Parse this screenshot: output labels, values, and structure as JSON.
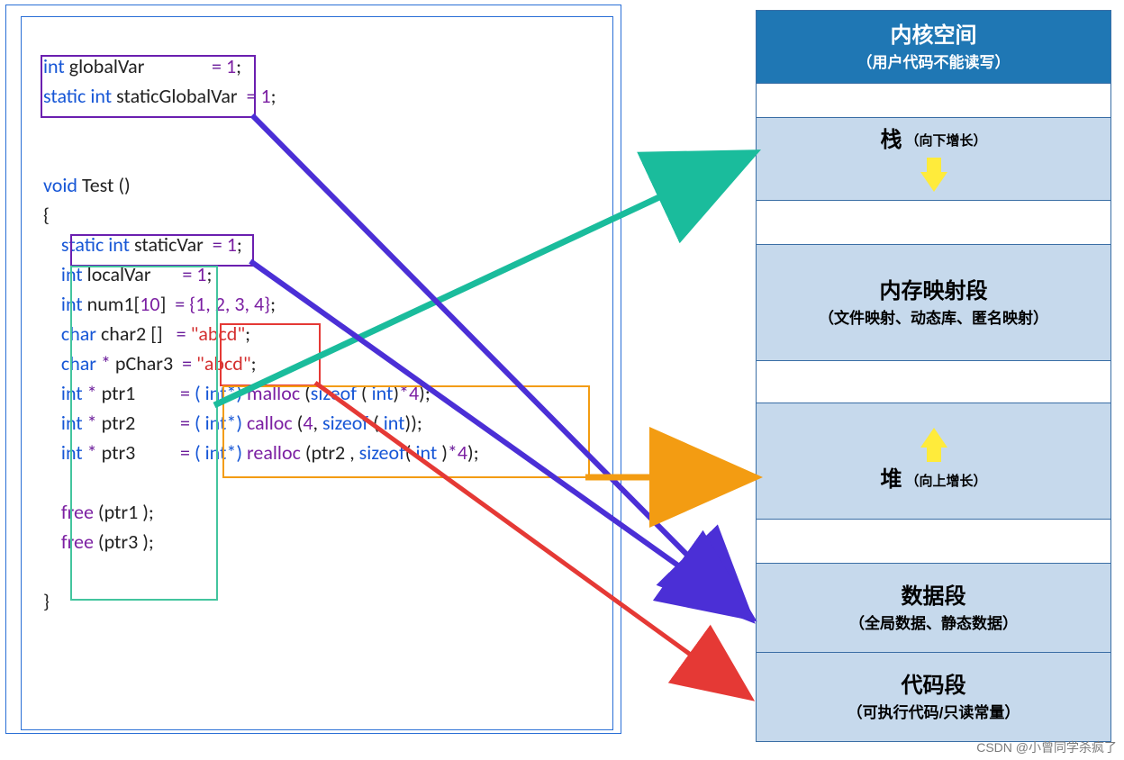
{
  "code": {
    "kw_int": "int",
    "kw_static": "static",
    "kw_void": "void",
    "kw_char": "char",
    "kw_sizeof": "sizeof",
    "globalVar": "globalVar",
    "staticGlobalVar": "staticGlobalVar",
    "Test": "Test",
    "staticVar": "staticVar",
    "localVar": "localVar",
    "num1": "num1",
    "num1_dim": "10",
    "arr_init": "{1, 2, 3, 4}",
    "char2": "char2",
    "pChar3": "pChar3",
    "str_abcd": "\"abcd\"",
    "ptr1": "ptr1",
    "ptr2": "ptr2",
    "ptr3": "ptr3",
    "malloc": "malloc",
    "calloc": "calloc",
    "realloc": "realloc",
    "free": "free",
    "one": "1",
    "four": "4",
    "eq": "=",
    "semi": ";",
    "star": "*",
    "cast_intp": "( int*)",
    "lp": "(",
    "rp": ")",
    "lb": "{",
    "rb": "}",
    "lbr": "[",
    "rbr": "]",
    "comma": ",",
    "sb_open": "[]"
  },
  "mem": {
    "row0": {
      "title": "内核空间",
      "sub": "（用户代码不能读写）"
    },
    "row2": {
      "title": "栈",
      "sub": "（向下增长）"
    },
    "row4": {
      "title": "内存映射段",
      "sub": "（文件映射、动态库、匿名映射）"
    },
    "row6": {
      "title": "堆",
      "sub": "（向上增长）"
    },
    "row8": {
      "title": "数据段",
      "sub": "（全局数据、静态数据）"
    },
    "row9": {
      "title": "代码段",
      "sub": "（可执行代码/只读常量）"
    }
  },
  "colors": {
    "kernel_bg": "#1f77b4",
    "kernel_fg": "#ffffff",
    "band_light": "#c6d9ec",
    "band_white": "#ffffff",
    "arrow_green": "#1abc9c",
    "arrow_purple": "#4b2fd6",
    "arrow_orange": "#f39c12",
    "arrow_red": "#e53935"
  },
  "watermark": "CSDN @小曾同学杀疯了"
}
